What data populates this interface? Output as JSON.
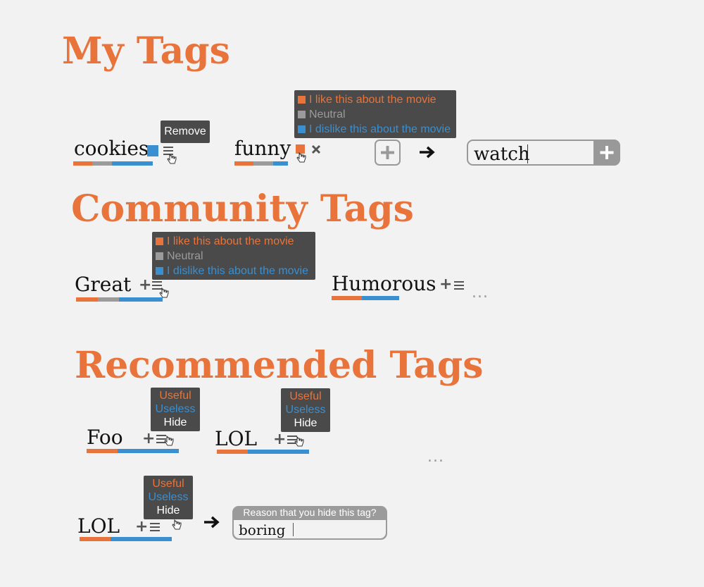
{
  "sections": {
    "my_tags": "My Tags",
    "community_tags": "Community Tags",
    "recommended_tags": "Recommended Tags"
  },
  "my_tags": {
    "tag1": {
      "label": "cookies",
      "tooltip": "Remove"
    },
    "tag2": {
      "label": "funny"
    },
    "sentiment_menu": {
      "like": "I like this about the movie",
      "neutral": "Neutral",
      "dislike": "I dislike this about the movie"
    },
    "input": {
      "value": "watch"
    }
  },
  "community": {
    "tag1": {
      "label": "Great"
    },
    "tag2": {
      "label": "Humorous"
    },
    "sentiment_menu": {
      "like": "I like this about the movie",
      "neutral": "Neutral",
      "dislike": "I dislike this about the movie"
    },
    "more": "..."
  },
  "recommended": {
    "tag1": {
      "label": "Foo"
    },
    "tag2": {
      "label": "LOL"
    },
    "tag3": {
      "label": "LOL"
    },
    "vote_menu": {
      "useful": "Useful",
      "useless": "Useless",
      "hide": "Hide"
    },
    "more": "...",
    "reason": {
      "prompt": "Reason that you hide this tag?",
      "value": "boring"
    }
  },
  "colors": {
    "accent": "#e8743b",
    "like": "#e8743b",
    "neutral": "#9b9b9b",
    "dislike": "#3a8fd0",
    "tooltip_bg": "#4a4a4a"
  },
  "icons": [
    "plus-icon",
    "menu-icon",
    "hand-cursor-icon",
    "close-icon",
    "arrow-right-icon"
  ]
}
